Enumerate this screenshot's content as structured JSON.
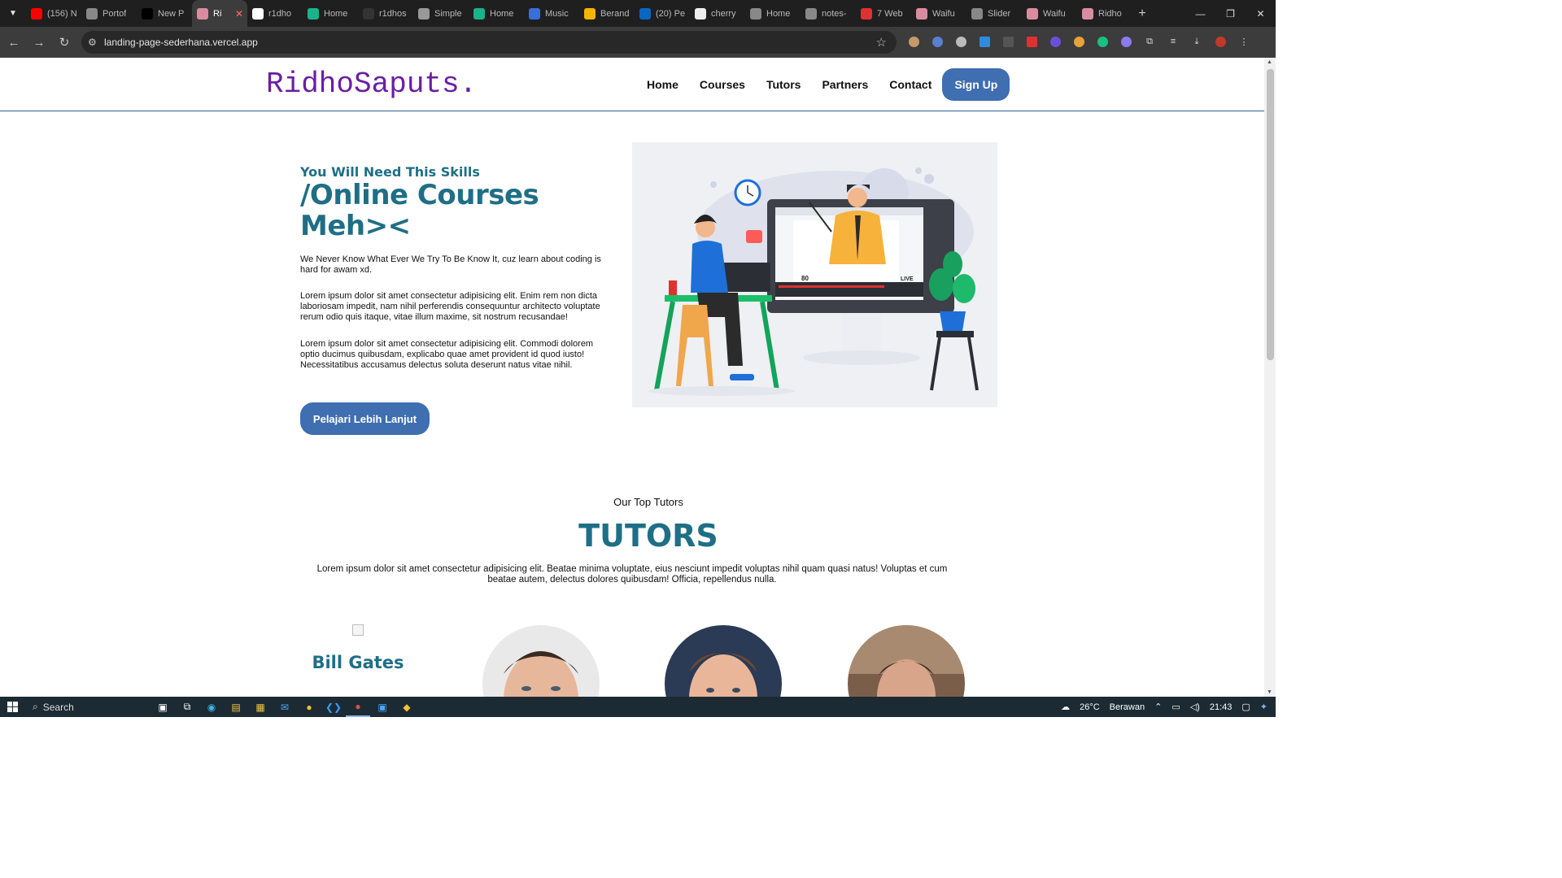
{
  "browser": {
    "tabs": [
      {
        "title": "(156) N",
        "color": "#ff0000"
      },
      {
        "title": "Portof",
        "color": "#888888"
      },
      {
        "title": "New P",
        "color": "#000000"
      },
      {
        "title": "Ri",
        "color": "#d98ca0",
        "active": true
      },
      {
        "title": "r1dho",
        "color": "#ffffff"
      },
      {
        "title": "Home",
        "color": "#18b48a"
      },
      {
        "title": "r1dhos",
        "color": "#333333"
      },
      {
        "title": "Simple",
        "color": "#999999"
      },
      {
        "title": "Home",
        "color": "#18b48a"
      },
      {
        "title": "Music",
        "color": "#3a6fd8"
      },
      {
        "title": "Berand",
        "color": "#f4b400"
      },
      {
        "title": "(20) Pe",
        "color": "#0a66c2"
      },
      {
        "title": "cherry",
        "color": "#eeeeee"
      },
      {
        "title": "Home",
        "color": "#888888"
      },
      {
        "title": "notes-",
        "color": "#888888"
      },
      {
        "title": "7 Web",
        "color": "#e03131"
      },
      {
        "title": "Waifu",
        "color": "#d98ca0"
      },
      {
        "title": "Slider",
        "color": "#888888"
      },
      {
        "title": "Waifu",
        "color": "#d98ca0"
      },
      {
        "title": "Ridho",
        "color": "#d98ca0"
      }
    ],
    "new_tab": "+",
    "url": "landing-page-sederhana.vercel.app"
  },
  "site": {
    "logo": "RidhoSaputs.",
    "nav": [
      "Home",
      "Courses",
      "Tutors",
      "Partners",
      "Contact"
    ],
    "signup": "Sign Up"
  },
  "hero": {
    "kicker": "You Will Need This Skills",
    "title": "/Online Courses Meh><",
    "paragraphs": [
      "We Never Know What Ever We Try To Be Know It, cuz learn about coding is hard for awam xd.",
      "Lorem ipsum dolor sit amet consectetur adipisicing elit. Enim rem non dicta laboriosam impedit, nam nihil perferendis consequuntur architecto voluptate rerum odio quis itaque, vitae illum maxime, sit nostrum recusandae!",
      "Lorem ipsum dolor sit amet consectetur adipisicing elit. Commodi dolorem optio ducimus quibusdam, explicabo quae amet provident id quod iusto! Necessitatibus accusamus delectus soluta deserunt natus vitae nihil."
    ],
    "cta": "Pelajari Lebih Lanjut",
    "live_views": "80",
    "live_label": "LIVE"
  },
  "tutors": {
    "subtitle": "Our Top Tutors",
    "title": "TUTORS",
    "description": "Lorem ipsum dolor sit amet consectetur adipisicing elit. Beatae minima voluptate, eius nesciunt impedit voluptas nihil quam quasi natus! Voluptas et cum beatae autem, delectus dolores quibusdam! Officia, repellendus nulla.",
    "first_name": "Bill Gates"
  },
  "taskbar": {
    "search": "Search",
    "weather": "26°C",
    "weather_text": "Berawan",
    "time": "21:43"
  }
}
